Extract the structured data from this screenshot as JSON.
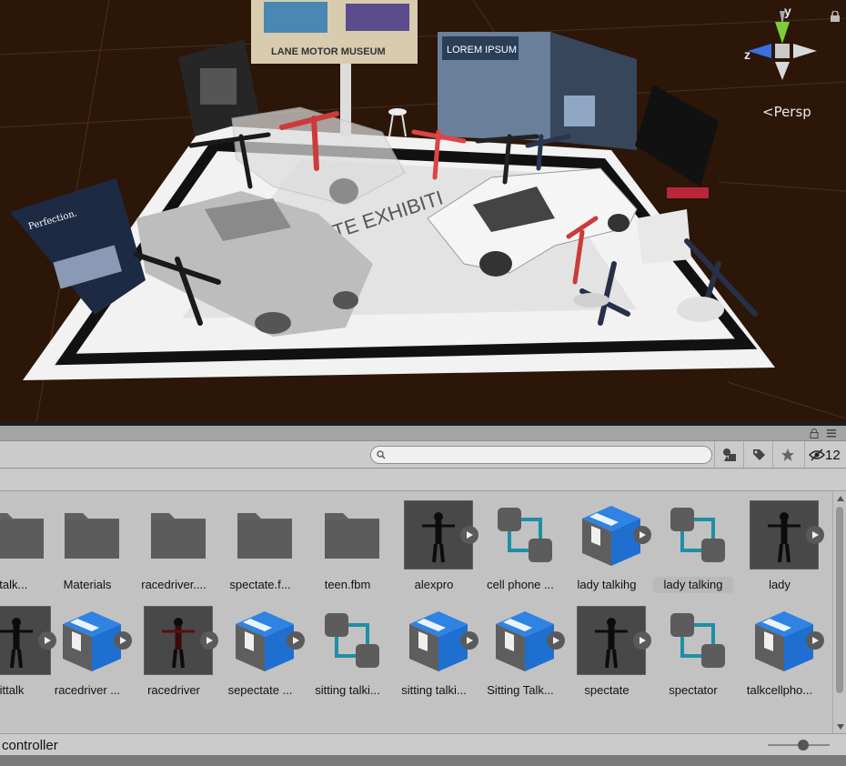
{
  "scene": {
    "projection_label": "<Persp",
    "axis_labels": {
      "y": "y",
      "z": "z"
    },
    "colors": {
      "background": "#2b1608",
      "floor": "#ffffff",
      "border": "#111111"
    }
  },
  "project": {
    "search": {
      "value": "",
      "placeholder": ""
    },
    "toolbar": {
      "filter_by_type_icon": "shapes-icon",
      "filter_by_label_icon": "tag-icon",
      "favorites_icon": "star-icon",
      "hidden_count": "12"
    },
    "row1": [
      {
        "label": "ttalk...",
        "kind": "folder"
      },
      {
        "label": "Materials",
        "kind": "folder"
      },
      {
        "label": "racedriver....",
        "kind": "folder"
      },
      {
        "label": "spectate.f...",
        "kind": "folder"
      },
      {
        "label": "teen.fbm",
        "kind": "folder"
      },
      {
        "label": "alexpro",
        "kind": "avatar"
      },
      {
        "label": "cell phone ...",
        "kind": "animator"
      },
      {
        "label": "lady talkihg",
        "kind": "prefab"
      },
      {
        "label": "lady talking",
        "kind": "animator",
        "selected": true
      },
      {
        "label": "lady",
        "kind": "avatar"
      }
    ],
    "row2": [
      {
        "label": "ittalk",
        "kind": "avatar"
      },
      {
        "label": "racedriver ...",
        "kind": "prefab"
      },
      {
        "label": "racedriver",
        "kind": "avatar_red"
      },
      {
        "label": "sepectate ...",
        "kind": "prefab"
      },
      {
        "label": "sitting talki...",
        "kind": "animator"
      },
      {
        "label": "sitting talki...",
        "kind": "prefab"
      },
      {
        "label": "Sitting Talk...",
        "kind": "prefab"
      },
      {
        "label": "spectate",
        "kind": "avatar"
      },
      {
        "label": "spectator",
        "kind": "animator"
      },
      {
        "label": "talkcellpho...",
        "kind": "prefab"
      }
    ],
    "status_path": "controller"
  }
}
